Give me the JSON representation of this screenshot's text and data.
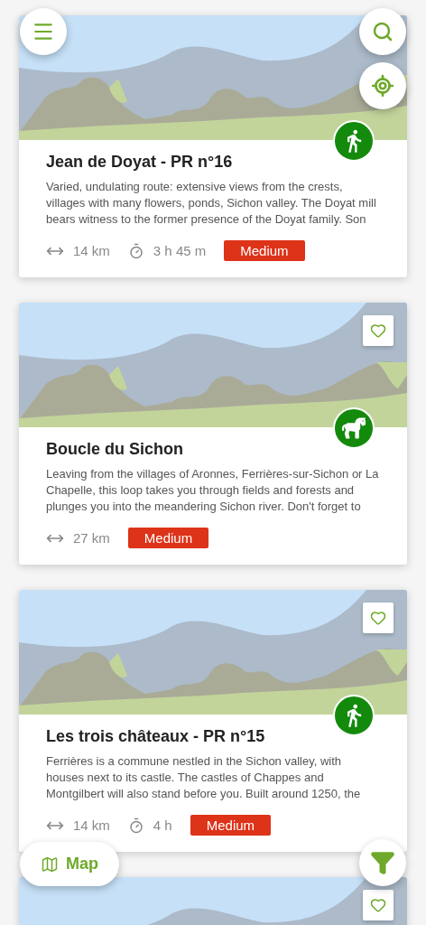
{
  "trails": [
    {
      "title": "Jean de Doyat - PR n°16",
      "description": "Varied, undulating route: extensive views from the crests, villages with many flowers, ponds, Sichon valley. The Doyat mill bears witness to the former presence of the Doyat family. Son",
      "distance": "14 km",
      "duration": "3 h 45 m",
      "difficulty": "Medium",
      "kind": "walking"
    },
    {
      "title": "Boucle du Sichon",
      "description": "Leaving from the villages of Aronnes, Ferrières-sur-Sichon or La Chapelle, this loop takes you through fields and forests and plunges you into the meandering Sichon river. Don't forget to",
      "distance": "27 km",
      "difficulty": "Medium",
      "kind": "horse",
      "favorite": false
    },
    {
      "title": "Les trois châteaux - PR n°15",
      "description": "Ferrières is a commune nestled in the Sichon valley, with houses next to its castle. The castles of Chappes and Montgilbert will also stand before you. Built around 1250, the",
      "distance": "14 km",
      "duration": "4 h",
      "difficulty": "Medium",
      "kind": "walking",
      "favorite": false
    },
    {
      "kind": "preview",
      "favorite": false
    }
  ],
  "map_button": {
    "label": "Map"
  }
}
